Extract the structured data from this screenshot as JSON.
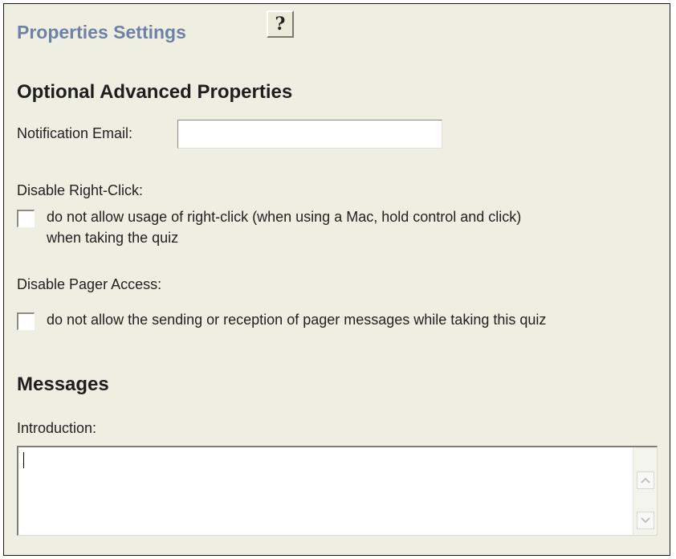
{
  "header": {
    "title": "Properties Settings",
    "help_glyph": "?"
  },
  "advanced": {
    "heading": "Optional Advanced Properties",
    "notification_email_label": "Notification Email:",
    "notification_email_value": "",
    "disable_right_click_label": "Disable Right-Click:",
    "right_click_option_line1": "do not allow usage of right-click (when using a Mac, hold control and click)",
    "right_click_option_line2": "when taking the quiz",
    "right_click_checked": false,
    "disable_pager_label": "Disable Pager Access:",
    "pager_option": "do not allow the sending or reception of pager messages while taking this quiz",
    "pager_checked": false
  },
  "messages": {
    "heading": "Messages",
    "introduction_label": "Introduction:",
    "introduction_value": ""
  },
  "icons": {
    "help": "question-mark-icon",
    "scroll_up": "scroll-up-arrow-icon",
    "scroll_down": "scroll-down-arrow-icon"
  },
  "colors": {
    "panel_background": "#eeeee2",
    "title_color": "#6f82a6",
    "heading_color": "#1e1e1e"
  }
}
